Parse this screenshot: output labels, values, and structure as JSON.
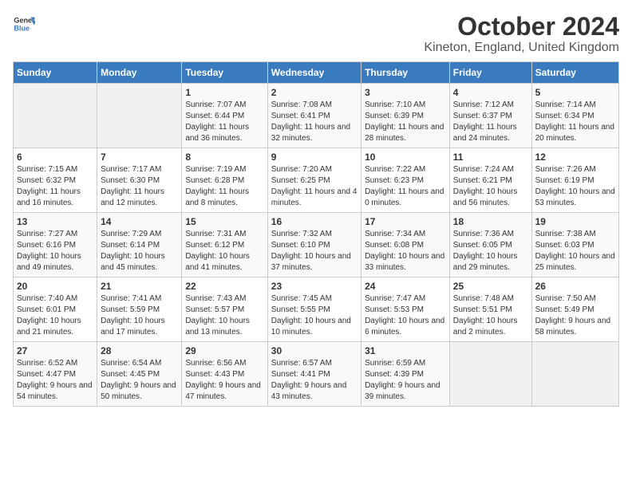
{
  "logo": {
    "line1": "General",
    "line2": "Blue"
  },
  "title": "October 2024",
  "subtitle": "Kineton, England, United Kingdom",
  "days_of_week": [
    "Sunday",
    "Monday",
    "Tuesday",
    "Wednesday",
    "Thursday",
    "Friday",
    "Saturday"
  ],
  "weeks": [
    [
      {
        "day": "",
        "empty": true
      },
      {
        "day": "",
        "empty": true
      },
      {
        "day": "1",
        "sunrise": "Sunrise: 7:07 AM",
        "sunset": "Sunset: 6:44 PM",
        "daylight": "Daylight: 11 hours and 36 minutes."
      },
      {
        "day": "2",
        "sunrise": "Sunrise: 7:08 AM",
        "sunset": "Sunset: 6:41 PM",
        "daylight": "Daylight: 11 hours and 32 minutes."
      },
      {
        "day": "3",
        "sunrise": "Sunrise: 7:10 AM",
        "sunset": "Sunset: 6:39 PM",
        "daylight": "Daylight: 11 hours and 28 minutes."
      },
      {
        "day": "4",
        "sunrise": "Sunrise: 7:12 AM",
        "sunset": "Sunset: 6:37 PM",
        "daylight": "Daylight: 11 hours and 24 minutes."
      },
      {
        "day": "5",
        "sunrise": "Sunrise: 7:14 AM",
        "sunset": "Sunset: 6:34 PM",
        "daylight": "Daylight: 11 hours and 20 minutes."
      }
    ],
    [
      {
        "day": "6",
        "sunrise": "Sunrise: 7:15 AM",
        "sunset": "Sunset: 6:32 PM",
        "daylight": "Daylight: 11 hours and 16 minutes."
      },
      {
        "day": "7",
        "sunrise": "Sunrise: 7:17 AM",
        "sunset": "Sunset: 6:30 PM",
        "daylight": "Daylight: 11 hours and 12 minutes."
      },
      {
        "day": "8",
        "sunrise": "Sunrise: 7:19 AM",
        "sunset": "Sunset: 6:28 PM",
        "daylight": "Daylight: 11 hours and 8 minutes."
      },
      {
        "day": "9",
        "sunrise": "Sunrise: 7:20 AM",
        "sunset": "Sunset: 6:25 PM",
        "daylight": "Daylight: 11 hours and 4 minutes."
      },
      {
        "day": "10",
        "sunrise": "Sunrise: 7:22 AM",
        "sunset": "Sunset: 6:23 PM",
        "daylight": "Daylight: 11 hours and 0 minutes."
      },
      {
        "day": "11",
        "sunrise": "Sunrise: 7:24 AM",
        "sunset": "Sunset: 6:21 PM",
        "daylight": "Daylight: 10 hours and 56 minutes."
      },
      {
        "day": "12",
        "sunrise": "Sunrise: 7:26 AM",
        "sunset": "Sunset: 6:19 PM",
        "daylight": "Daylight: 10 hours and 53 minutes."
      }
    ],
    [
      {
        "day": "13",
        "sunrise": "Sunrise: 7:27 AM",
        "sunset": "Sunset: 6:16 PM",
        "daylight": "Daylight: 10 hours and 49 minutes."
      },
      {
        "day": "14",
        "sunrise": "Sunrise: 7:29 AM",
        "sunset": "Sunset: 6:14 PM",
        "daylight": "Daylight: 10 hours and 45 minutes."
      },
      {
        "day": "15",
        "sunrise": "Sunrise: 7:31 AM",
        "sunset": "Sunset: 6:12 PM",
        "daylight": "Daylight: 10 hours and 41 minutes."
      },
      {
        "day": "16",
        "sunrise": "Sunrise: 7:32 AM",
        "sunset": "Sunset: 6:10 PM",
        "daylight": "Daylight: 10 hours and 37 minutes."
      },
      {
        "day": "17",
        "sunrise": "Sunrise: 7:34 AM",
        "sunset": "Sunset: 6:08 PM",
        "daylight": "Daylight: 10 hours and 33 minutes."
      },
      {
        "day": "18",
        "sunrise": "Sunrise: 7:36 AM",
        "sunset": "Sunset: 6:05 PM",
        "daylight": "Daylight: 10 hours and 29 minutes."
      },
      {
        "day": "19",
        "sunrise": "Sunrise: 7:38 AM",
        "sunset": "Sunset: 6:03 PM",
        "daylight": "Daylight: 10 hours and 25 minutes."
      }
    ],
    [
      {
        "day": "20",
        "sunrise": "Sunrise: 7:40 AM",
        "sunset": "Sunset: 6:01 PM",
        "daylight": "Daylight: 10 hours and 21 minutes."
      },
      {
        "day": "21",
        "sunrise": "Sunrise: 7:41 AM",
        "sunset": "Sunset: 5:59 PM",
        "daylight": "Daylight: 10 hours and 17 minutes."
      },
      {
        "day": "22",
        "sunrise": "Sunrise: 7:43 AM",
        "sunset": "Sunset: 5:57 PM",
        "daylight": "Daylight: 10 hours and 13 minutes."
      },
      {
        "day": "23",
        "sunrise": "Sunrise: 7:45 AM",
        "sunset": "Sunset: 5:55 PM",
        "daylight": "Daylight: 10 hours and 10 minutes."
      },
      {
        "day": "24",
        "sunrise": "Sunrise: 7:47 AM",
        "sunset": "Sunset: 5:53 PM",
        "daylight": "Daylight: 10 hours and 6 minutes."
      },
      {
        "day": "25",
        "sunrise": "Sunrise: 7:48 AM",
        "sunset": "Sunset: 5:51 PM",
        "daylight": "Daylight: 10 hours and 2 minutes."
      },
      {
        "day": "26",
        "sunrise": "Sunrise: 7:50 AM",
        "sunset": "Sunset: 5:49 PM",
        "daylight": "Daylight: 9 hours and 58 minutes."
      }
    ],
    [
      {
        "day": "27",
        "sunrise": "Sunrise: 6:52 AM",
        "sunset": "Sunset: 4:47 PM",
        "daylight": "Daylight: 9 hours and 54 minutes."
      },
      {
        "day": "28",
        "sunrise": "Sunrise: 6:54 AM",
        "sunset": "Sunset: 4:45 PM",
        "daylight": "Daylight: 9 hours and 50 minutes."
      },
      {
        "day": "29",
        "sunrise": "Sunrise: 6:56 AM",
        "sunset": "Sunset: 4:43 PM",
        "daylight": "Daylight: 9 hours and 47 minutes."
      },
      {
        "day": "30",
        "sunrise": "Sunrise: 6:57 AM",
        "sunset": "Sunset: 4:41 PM",
        "daylight": "Daylight: 9 hours and 43 minutes."
      },
      {
        "day": "31",
        "sunrise": "Sunrise: 6:59 AM",
        "sunset": "Sunset: 4:39 PM",
        "daylight": "Daylight: 9 hours and 39 minutes."
      },
      {
        "day": "",
        "empty": true
      },
      {
        "day": "",
        "empty": true
      }
    ]
  ]
}
